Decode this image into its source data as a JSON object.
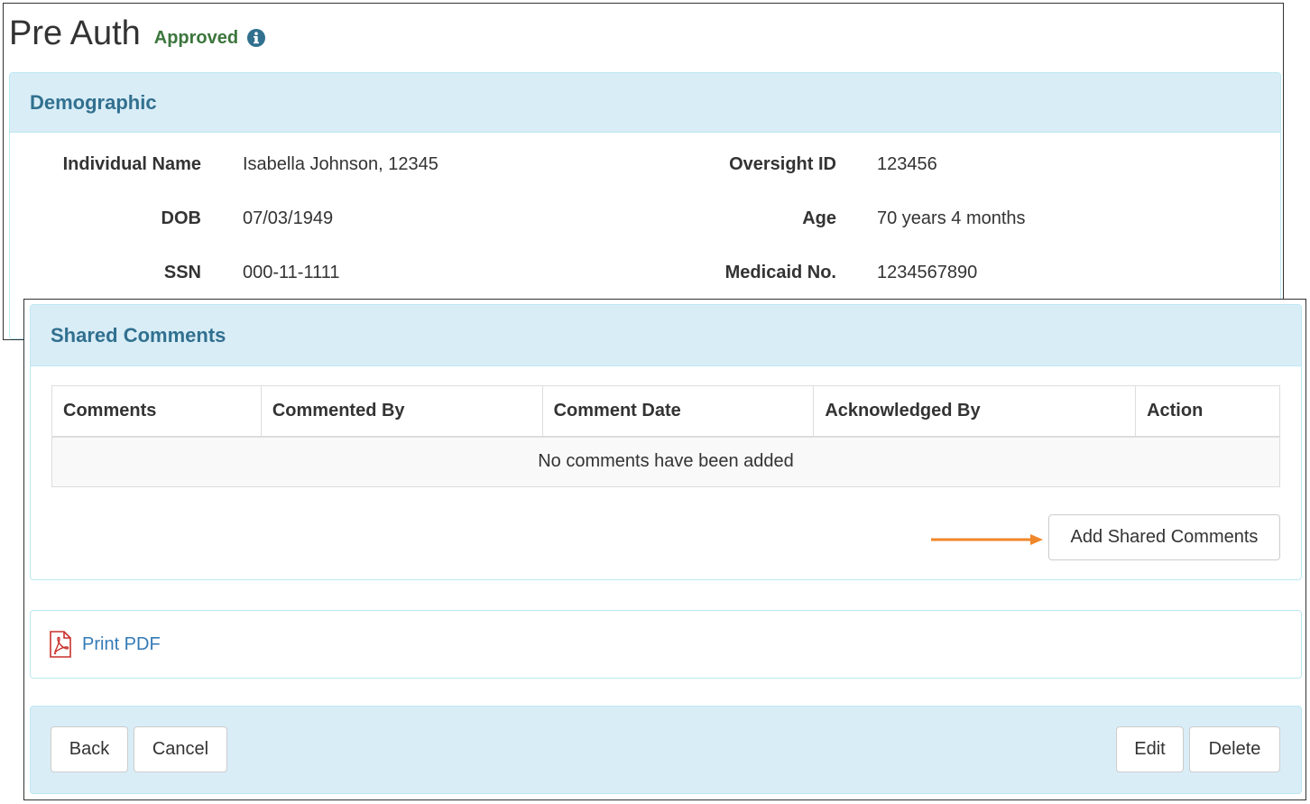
{
  "header": {
    "title": "Pre Auth",
    "status": "Approved",
    "status_color": "#3c763d",
    "info_icon": "info-circle-icon"
  },
  "demographic": {
    "heading": "Demographic",
    "fields": [
      {
        "label": "Individual Name",
        "value": "Isabella Johnson, 12345"
      },
      {
        "label": "Oversight ID",
        "value": "123456"
      },
      {
        "label": "DOB",
        "value": "07/03/1949"
      },
      {
        "label": "Age",
        "value": "70 years 4 months"
      },
      {
        "label": "SSN",
        "value": "000-11-1111"
      },
      {
        "label": "Medicaid No.",
        "value": "1234567890"
      }
    ]
  },
  "shared_comments": {
    "heading": "Shared Comments",
    "columns": [
      "Comments",
      "Commented By",
      "Comment Date",
      "Acknowledged By",
      "Action"
    ],
    "empty_message": "No comments have been added",
    "add_button_label": "Add Shared Comments",
    "arrow_color": "#f0872a"
  },
  "print": {
    "link_label": "Print PDF",
    "icon": "pdf-file-icon"
  },
  "footer": {
    "back_label": "Back",
    "cancel_label": "Cancel",
    "edit_label": "Edit",
    "delete_label": "Delete"
  },
  "colors": {
    "panel_heading_bg": "#d9edf7",
    "panel_border": "#bce8f1",
    "heading_text": "#31708f",
    "link": "#337ab7"
  }
}
